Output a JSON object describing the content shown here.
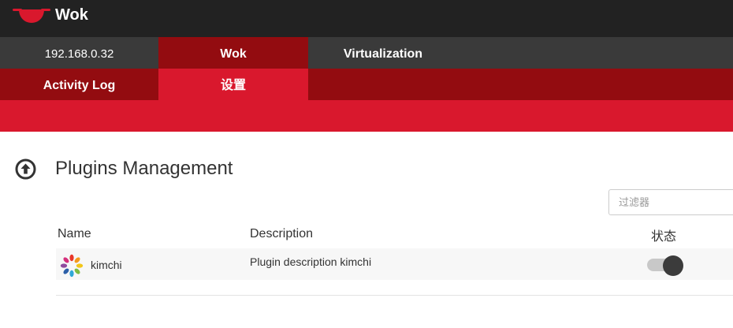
{
  "app": {
    "brand_name": "Wok",
    "logo_icon": "wok-pan-icon"
  },
  "nav_primary": {
    "host": "192.168.0.32",
    "tabs": [
      {
        "label": "Wok",
        "active": true
      },
      {
        "label": "Virtualization",
        "active": false
      }
    ]
  },
  "nav_secondary": {
    "tabs": [
      {
        "label": "Activity Log",
        "active": false
      },
      {
        "label": "设置",
        "active": true
      }
    ]
  },
  "section": {
    "title": "Plugins Management",
    "collapse_icon": "circle-arrow-up-icon"
  },
  "filter": {
    "placeholder": "过滤器",
    "value": ""
  },
  "table": {
    "columns": {
      "name": "Name",
      "description": "Description",
      "status": "状态"
    },
    "rows": [
      {
        "name": "kimchi",
        "description": "Plugin description kimchi",
        "enabled": true,
        "icon": "kimchi-logo-icon"
      }
    ]
  },
  "colors": {
    "topbar": "#222222",
    "nav_dark": "#3a3a3a",
    "brand_dark_red": "#930c10",
    "brand_red": "#d9182d"
  }
}
